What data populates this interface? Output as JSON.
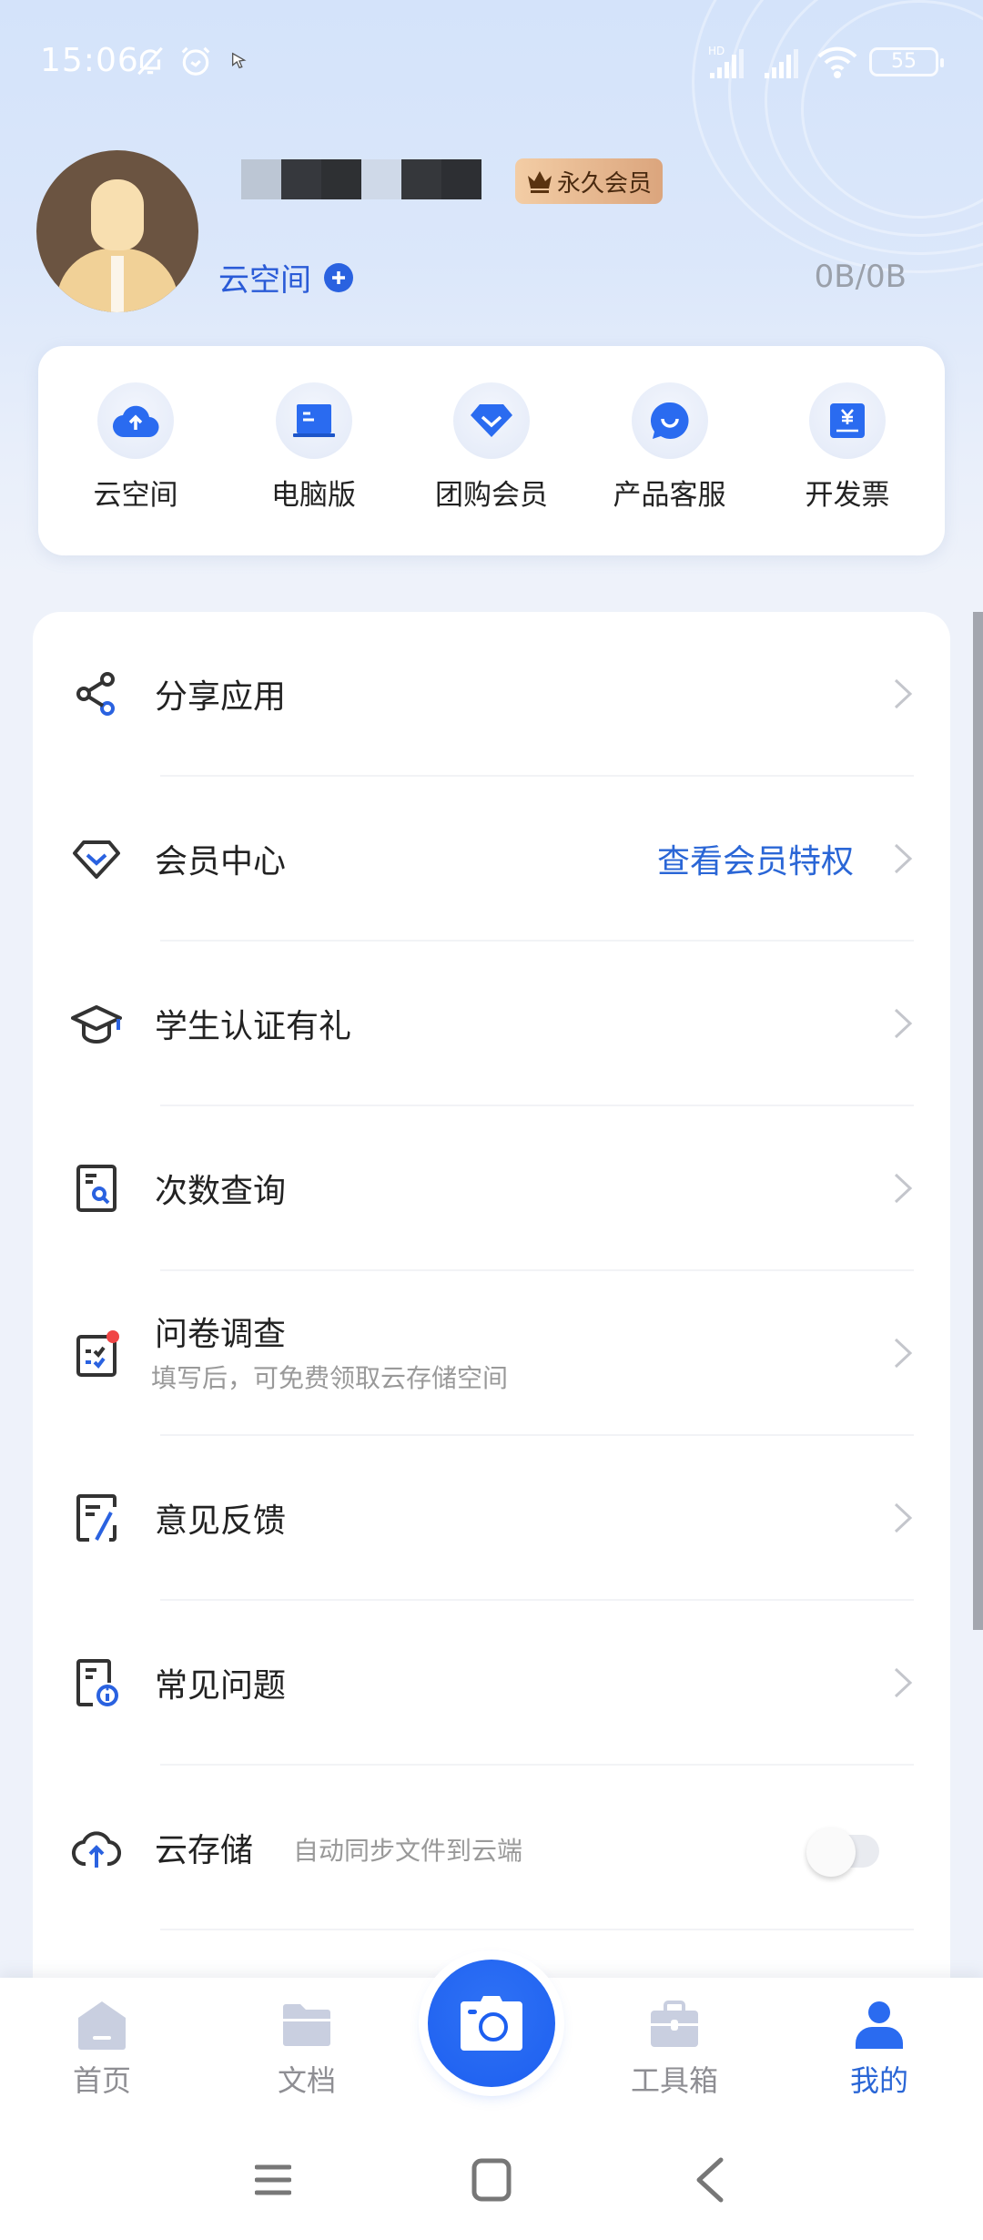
{
  "status_bar": {
    "time": "15:06",
    "battery": "55",
    "icons": [
      "mute-bell-icon",
      "alarm-icon",
      "cursor-icon",
      "hd-signal-icon",
      "signal-icon",
      "wifi-icon",
      "battery-icon"
    ]
  },
  "profile": {
    "username": "[redacted]",
    "badge": "永久会员",
    "cloud_link": "云空间",
    "storage_usage": "0B/0B"
  },
  "quick_actions": [
    {
      "label": "云空间",
      "icon": "cloud-upload-icon"
    },
    {
      "label": "电脑版",
      "icon": "laptop-icon"
    },
    {
      "label": "团购会员",
      "icon": "diamond-icon"
    },
    {
      "label": "产品客服",
      "icon": "chat-bubble-icon"
    },
    {
      "label": "开发票",
      "icon": "invoice-yen-icon"
    }
  ],
  "menu": [
    {
      "label": "分享应用",
      "icon": "share-icon"
    },
    {
      "label": "会员中心",
      "icon": "diamond-outline-icon",
      "action": "查看会员特权"
    },
    {
      "label": "学生认证有礼",
      "icon": "graduation-cap-icon"
    },
    {
      "label": "次数查询",
      "icon": "document-search-icon"
    },
    {
      "label": "问卷调查",
      "icon": "survey-checklist-icon",
      "sub": "填写后，可免费领取云存储空间",
      "has_dot": true
    },
    {
      "label": "意见反馈",
      "icon": "feedback-edit-icon"
    },
    {
      "label": "常见问题",
      "icon": "faq-document-icon"
    },
    {
      "label": "云存储",
      "icon": "cloud-upload-outline-icon",
      "sub": "自动同步文件到云端",
      "toggle": false
    }
  ],
  "tab_bar": {
    "tabs": [
      {
        "label": "首页",
        "icon": "home-icon",
        "active": false
      },
      {
        "label": "文档",
        "icon": "folder-icon",
        "active": false
      },
      {
        "label": "工具箱",
        "icon": "toolbox-icon",
        "active": false
      },
      {
        "label": "我的",
        "icon": "profile-icon",
        "active": true
      }
    ],
    "camera": "camera-icon"
  },
  "colors": {
    "accent": "#2a66d6",
    "badge_gradient": [
      "#f3cda5",
      "#dba57d"
    ],
    "notification_dot": "#f04545"
  }
}
